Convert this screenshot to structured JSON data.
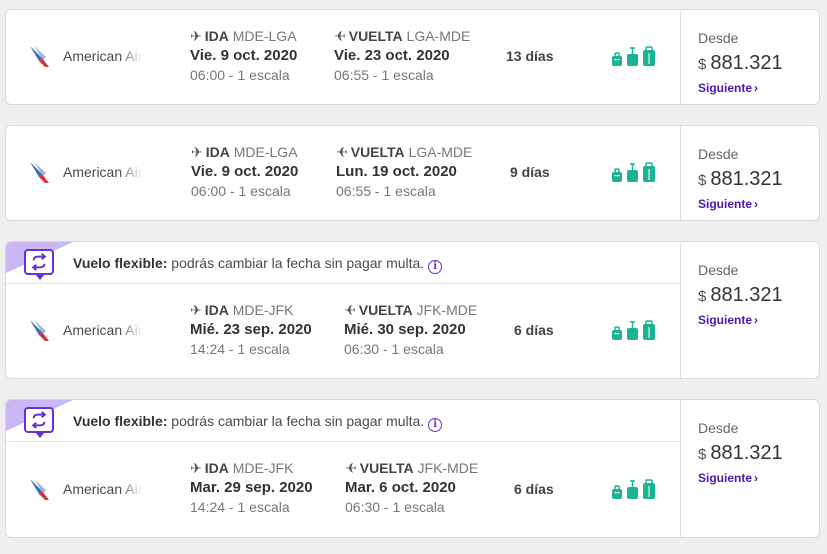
{
  "colors": {
    "accent": "#4a17b8",
    "flex_purple": "#6b2fd6",
    "flex_bg": "#c9b8f5",
    "bag_green": "#1bb394",
    "aa_red": "#d6323d",
    "aa_blue": "#3a6fb5"
  },
  "results": [
    {
      "flexible": false,
      "airline": "American Airlines",
      "outbound": {
        "label": "IDA",
        "icon": "plane-departure-icon",
        "route": "MDE-LGA",
        "date": "Vie. 9 oct. 2020",
        "time_stops": "06:00 - 1 escala"
      },
      "inbound": {
        "label": "VUELTA",
        "icon": "plane-return-icon",
        "route": "LGA-MDE",
        "date": "Vie. 23 oct. 2020",
        "time_stops": "06:55 - 1 escala"
      },
      "duration": "13 días",
      "price_label": "Desde",
      "currency": "$",
      "price": "881.321",
      "next_label": "Siguiente"
    },
    {
      "flexible": false,
      "airline": "American Airlines",
      "outbound": {
        "label": "IDA",
        "icon": "plane-departure-icon",
        "route": "MDE-LGA",
        "date": "Vie. 9 oct. 2020",
        "time_stops": "06:00 - 1 escala"
      },
      "inbound": {
        "label": "VUELTA",
        "icon": "plane-return-icon",
        "route": "LGA-MDE",
        "date": "Lun. 19 oct. 2020",
        "time_stops": "06:55 - 1 escala"
      },
      "duration": "9 días",
      "price_label": "Desde",
      "currency": "$",
      "price": "881.321",
      "next_label": "Siguiente"
    },
    {
      "flexible": true,
      "flex_title": "Vuelo flexible:",
      "flex_text": "podrás cambiar la fecha sin pagar multa.",
      "airline": "American Airlines",
      "outbound": {
        "label": "IDA",
        "icon": "plane-departure-icon",
        "route": "MDE-JFK",
        "date": "Mié. 23 sep. 2020",
        "time_stops": "14:24 - 1 escala"
      },
      "inbound": {
        "label": "VUELTA",
        "icon": "plane-return-icon",
        "route": "JFK-MDE",
        "date": "Mié. 30 sep. 2020",
        "time_stops": "06:30 - 1 escala"
      },
      "duration": "6 días",
      "price_label": "Desde",
      "currency": "$",
      "price": "881.321",
      "next_label": "Siguiente"
    },
    {
      "flexible": true,
      "flex_title": "Vuelo flexible:",
      "flex_text": "podrás cambiar la fecha sin pagar multa.",
      "airline": "American Airlines",
      "outbound": {
        "label": "IDA",
        "icon": "plane-departure-icon",
        "route": "MDE-JFK",
        "date": "Mar. 29 sep. 2020",
        "time_stops": "14:24 - 1 escala"
      },
      "inbound": {
        "label": "VUELTA",
        "icon": "plane-return-icon",
        "route": "JFK-MDE",
        "date": "Mar. 6 oct. 2020",
        "time_stops": "06:30 - 1 escala"
      },
      "duration": "6 días",
      "price_label": "Desde",
      "currency": "$",
      "price": "881.321",
      "next_label": "Siguiente"
    }
  ]
}
